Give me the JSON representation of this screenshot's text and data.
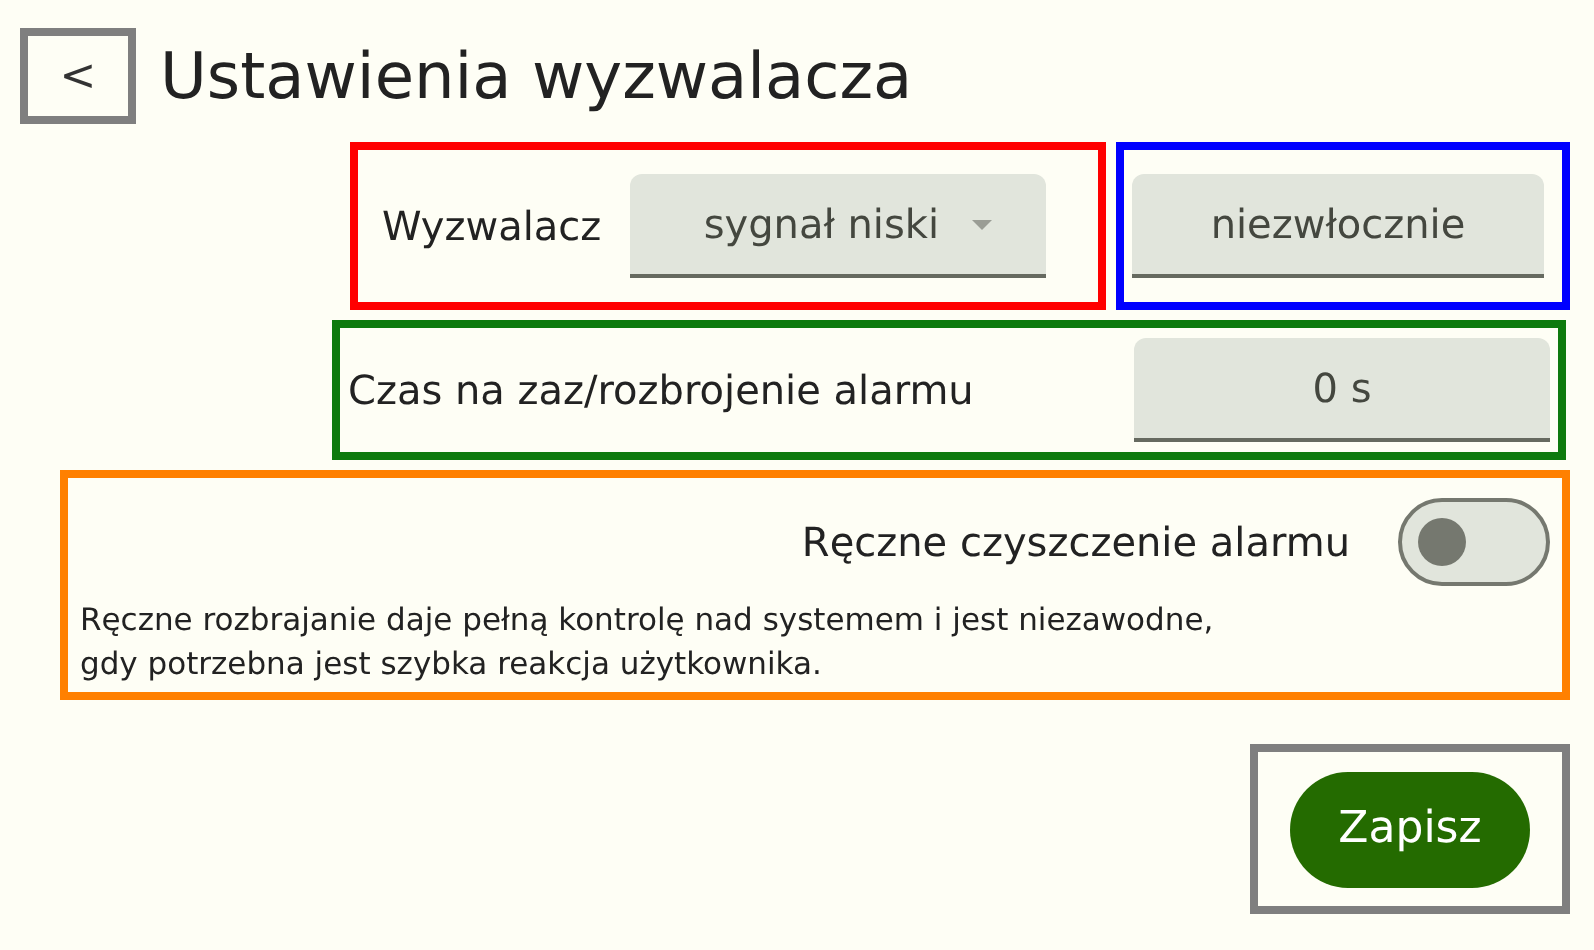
{
  "header": {
    "back": "<",
    "title": "Ustawienia wyzwalacza"
  },
  "trigger": {
    "label": "Wyzwalacz",
    "dropdown_value": "sygnał niski",
    "delay_value": "niezwłocznie"
  },
  "arm_time": {
    "label": "Czas na zaz/rozbrojenie alarmu",
    "value": "0 s"
  },
  "manual_clear": {
    "label": "Ręczne czyszczenie alarmu",
    "on": false,
    "description": "Ręczne rozbrajanie daje pełną kontrolę nad systemem i jest niezawodne,\ngdy potrzebna jest szybka reakcja użytkownika."
  },
  "save_button": "Zapisz"
}
